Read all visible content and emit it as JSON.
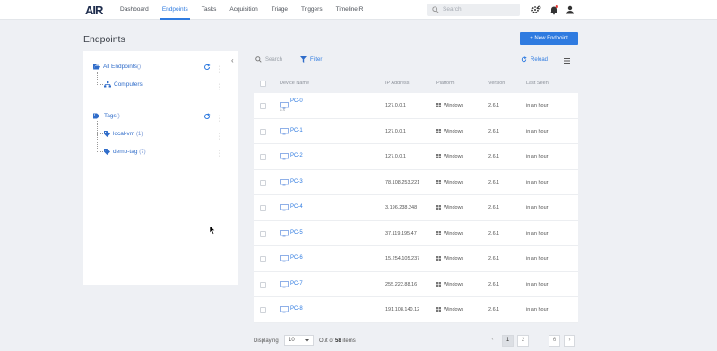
{
  "app": {
    "logo_a": "A",
    "logo_ir": "IR"
  },
  "nav": [
    "Dashboard",
    "Endpoints",
    "Tasks",
    "Acquisition",
    "Triage",
    "Triggers",
    "TimelineIR"
  ],
  "nav_active": 1,
  "search": {
    "placeholder": "Search"
  },
  "icons": {
    "settings": "gear-icon",
    "notifications": "bell-icon",
    "user": "user-icon"
  },
  "colors": {
    "accent": "#2f7be0",
    "notification": "#e53935"
  },
  "page_title": "Endpoints",
  "new_endpoint_label": "+ New Endpoint",
  "sidebar": {
    "all_endpoints": {
      "label": "All Endpoints",
      "count": "()"
    },
    "computers": {
      "label": "Computers"
    },
    "tags": {
      "label": "Tags",
      "count": "()"
    },
    "tag_items": [
      {
        "label": "local-vm",
        "count": "(1)"
      },
      {
        "label": "demo-tag",
        "count": "(7)"
      }
    ]
  },
  "toolbar": {
    "search": "Search",
    "filter": "Filter",
    "reload": "Reload"
  },
  "table": {
    "headers": [
      "Device Name",
      "IP Address",
      "Platform",
      "Version",
      "Last Seen"
    ],
    "rows": [
      {
        "name": "PC-0",
        "sub": "a.s",
        "ip": "127.0.0.1",
        "platform": "Windows",
        "version": "2.6.1",
        "last_seen": "in an hour"
      },
      {
        "name": "PC-1",
        "sub": "",
        "ip": "127.0.0.1",
        "platform": "Windows",
        "version": "2.6.1",
        "last_seen": "in an hour"
      },
      {
        "name": "PC-2",
        "sub": "",
        "ip": "127.0.0.1",
        "platform": "Windows",
        "version": "2.6.1",
        "last_seen": "in an hour"
      },
      {
        "name": "PC-3",
        "sub": "",
        "ip": "78.108.253.221",
        "platform": "Windows",
        "version": "2.6.1",
        "last_seen": "in an hour"
      },
      {
        "name": "PC-4",
        "sub": "",
        "ip": "3.196.238.248",
        "platform": "Windows",
        "version": "2.6.1",
        "last_seen": "in an hour"
      },
      {
        "name": "PC-5",
        "sub": "",
        "ip": "37.119.195.47",
        "platform": "Windows",
        "version": "2.6.1",
        "last_seen": "in an hour"
      },
      {
        "name": "PC-6",
        "sub": "",
        "ip": "15.254.105.237",
        "platform": "Windows",
        "version": "2.6.1",
        "last_seen": "in an hour"
      },
      {
        "name": "PC-7",
        "sub": "",
        "ip": "255.222.88.16",
        "platform": "Windows",
        "version": "2.6.1",
        "last_seen": "in an hour"
      },
      {
        "name": "PC-8",
        "sub": "",
        "ip": "191.108.140.12",
        "platform": "Windows",
        "version": "2.6.1",
        "last_seen": "in an hour"
      }
    ]
  },
  "footer": {
    "displaying": "Displaying",
    "page_size": "10",
    "out_of": "Out of",
    "total": "58",
    "items": "items",
    "prev": "‹",
    "next": "›",
    "pages": [
      "1",
      "2",
      "6"
    ]
  }
}
